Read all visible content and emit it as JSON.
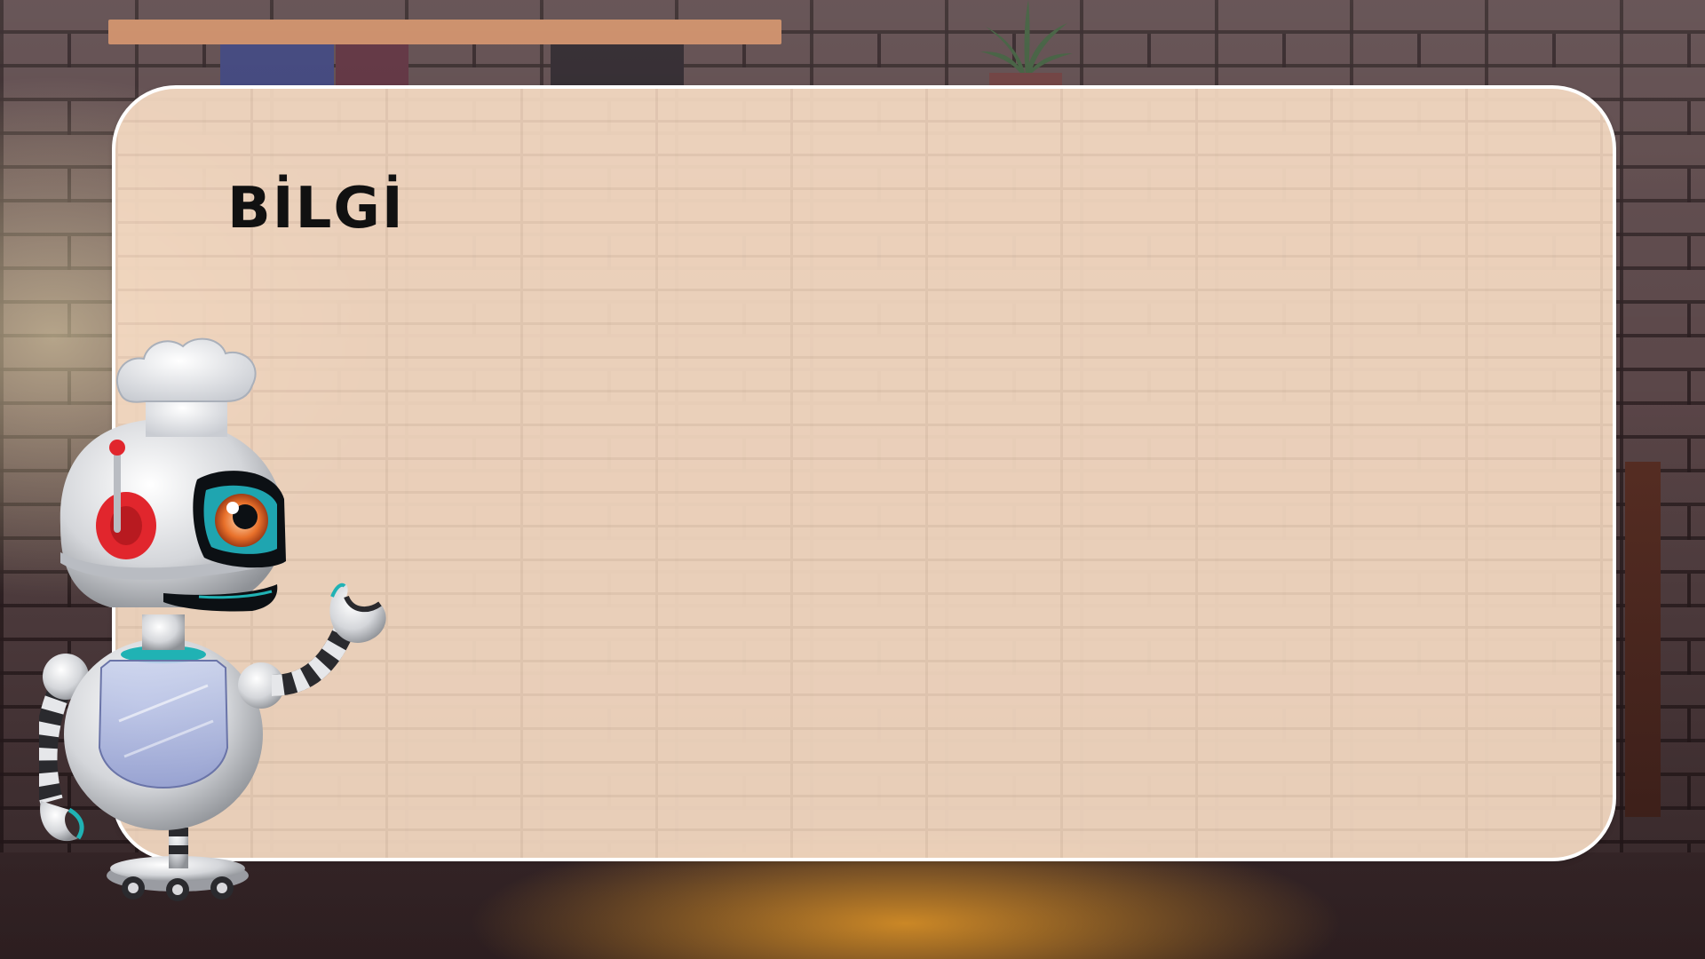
{
  "panel": {
    "title": "BİLGİ"
  },
  "mascot": {
    "name": "robot-chef"
  },
  "colors": {
    "panel_fill": "#f5dac3",
    "panel_border": "#ffffff",
    "title_text": "#111111",
    "robot_accent": "#e1262d",
    "robot_teal": "#20b2b4",
    "robot_eye": "#e8702a"
  }
}
